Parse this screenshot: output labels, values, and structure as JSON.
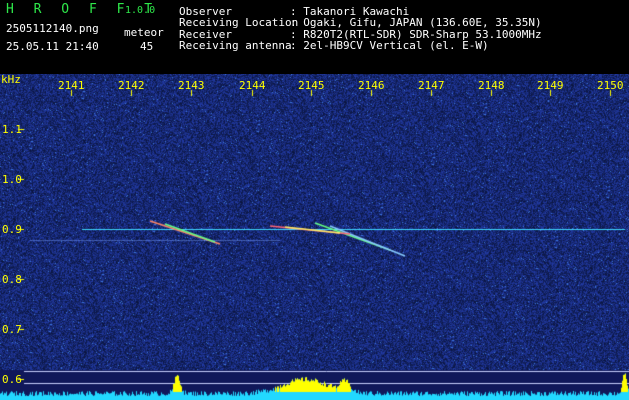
{
  "app": {
    "name": "H R O F F T",
    "version": "1.0.0"
  },
  "file": {
    "name": "2505112140.png",
    "datetime": "25.05.11 21:40"
  },
  "meteor": {
    "label": "meteor",
    "count": "45"
  },
  "info": [
    {
      "key": "Observer",
      "value": ": Takanori Kawachi"
    },
    {
      "key": "Receiving Location",
      "value": ": Ogaki, Gifu, JAPAN (136.60E, 35.35N)"
    },
    {
      "key": "Receiver",
      "value": ": R820T2(RTL-SDR) SDR-Sharp 53.1000MHz"
    },
    {
      "key": "Receiving antenna",
      "value": ": 2el-HB9CV Vertical (el. E-W)"
    }
  ],
  "axes": {
    "unit": "kHz",
    "time_ticks": [
      "2141",
      "2142",
      "2143",
      "2144",
      "2145",
      "2146",
      "2147",
      "2148",
      "2149",
      "2150"
    ],
    "freq_ticks": [
      "1.1",
      "1.0",
      "0.9",
      "0.8",
      "0.7",
      "0.6"
    ]
  },
  "colors": {
    "background": "#10185a",
    "tick_text": "#ffff00",
    "header_text": "#ffffff",
    "logo": "#2ee84a",
    "signal": "#3fd8ff",
    "level_bars": "#22d8ff",
    "level_peaks": "#ffff00"
  }
}
